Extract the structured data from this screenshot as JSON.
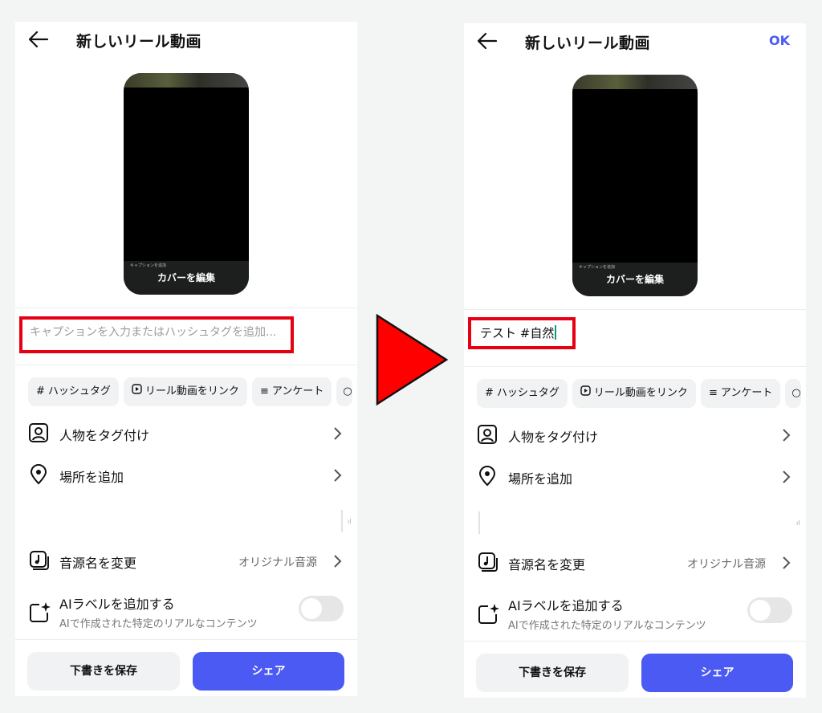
{
  "colors": {
    "accent": "#4a5af2",
    "highlight_box": "#e60012",
    "arrow": "#ff0000"
  },
  "left": {
    "title": "新しいリール動画",
    "cover_edit": "カバーを編集",
    "preview_small_text": "キャプションを追加",
    "caption_placeholder": "キャプションを入力またはハッシュタグを追加...",
    "chips": [
      "ハッシュタグ",
      "リール動画をリンク",
      "アンケート"
    ],
    "tag_people": "人物をタグ付け",
    "add_location": "場所を追加",
    "rename_audio": "音源名を変更",
    "audio_value": "オリジナル音源",
    "ai_label_title": "AIラベルを追加する",
    "ai_label_sub": "AIで作成された特定のリアルなコンテンツ",
    "ai_label_enabled": false,
    "save_draft": "下書きを保存",
    "share": "シェア"
  },
  "right": {
    "title": "新しいリール動画",
    "ok": "OK",
    "cover_edit": "カバーを編集",
    "preview_small_text": "キャプションを追加",
    "caption_value": "テスト #自然",
    "chips": [
      "ハッシュタグ",
      "リール動画をリンク",
      "アンケート"
    ],
    "tag_people": "人物をタグ付け",
    "add_location": "場所を追加",
    "rename_audio": "音源名を変更",
    "audio_value": "オリジナル音源",
    "ai_label_title": "AIラベルを追加する",
    "ai_label_sub": "AIで作成された特定のリアルなコンテンツ",
    "ai_label_enabled": false,
    "save_draft": "下書きを保存",
    "share": "シェア"
  },
  "icons": {
    "back": "arrow-left-icon",
    "hashtag": "hash-icon",
    "link_reel": "reel-link-icon",
    "poll": "poll-icon",
    "more": "search-icon",
    "tag_people": "person-tag-icon",
    "location": "location-pin-icon",
    "audio": "music-note-icon",
    "ai_label": "sparkle-square-icon",
    "chevron": "chevron-right-icon",
    "transition": "play-triangle-icon"
  }
}
